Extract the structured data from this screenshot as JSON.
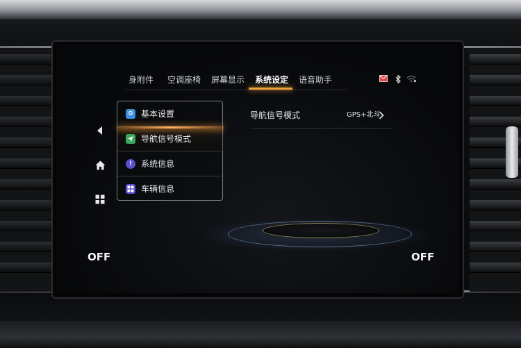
{
  "tabs": [
    {
      "label": "身附件"
    },
    {
      "label": "空调座椅"
    },
    {
      "label": "屏幕显示"
    },
    {
      "label": "系统设定",
      "active": true
    },
    {
      "label": "语音助手"
    }
  ],
  "status_bar": {
    "icons": [
      "mail-icon",
      "bluetooth-icon",
      "wifi-icon"
    ]
  },
  "side_nav": {
    "icons": [
      "back-icon",
      "home-icon",
      "apps-grid-icon"
    ]
  },
  "menu": {
    "items": [
      {
        "label": "基本设置",
        "icon": "gear-icon",
        "icon_color": "#3b8fe0"
      },
      {
        "label": "导航信号模式",
        "icon": "navigation-arrow-icon",
        "icon_color": "#3aa85c",
        "active": true
      },
      {
        "label": "系统信息",
        "icon": "info-icon",
        "icon_color": "#5a4fd0"
      },
      {
        "label": "车辆信息",
        "icon": "vehicle-info-icon",
        "icon_color": "#5a4fd0"
      }
    ]
  },
  "detail": {
    "label": "导航信号模式",
    "value": "GPS+北斗"
  },
  "climate": {
    "left_status": "OFF",
    "right_status": "OFF"
  },
  "colors": {
    "accent": "#f0a43a"
  }
}
